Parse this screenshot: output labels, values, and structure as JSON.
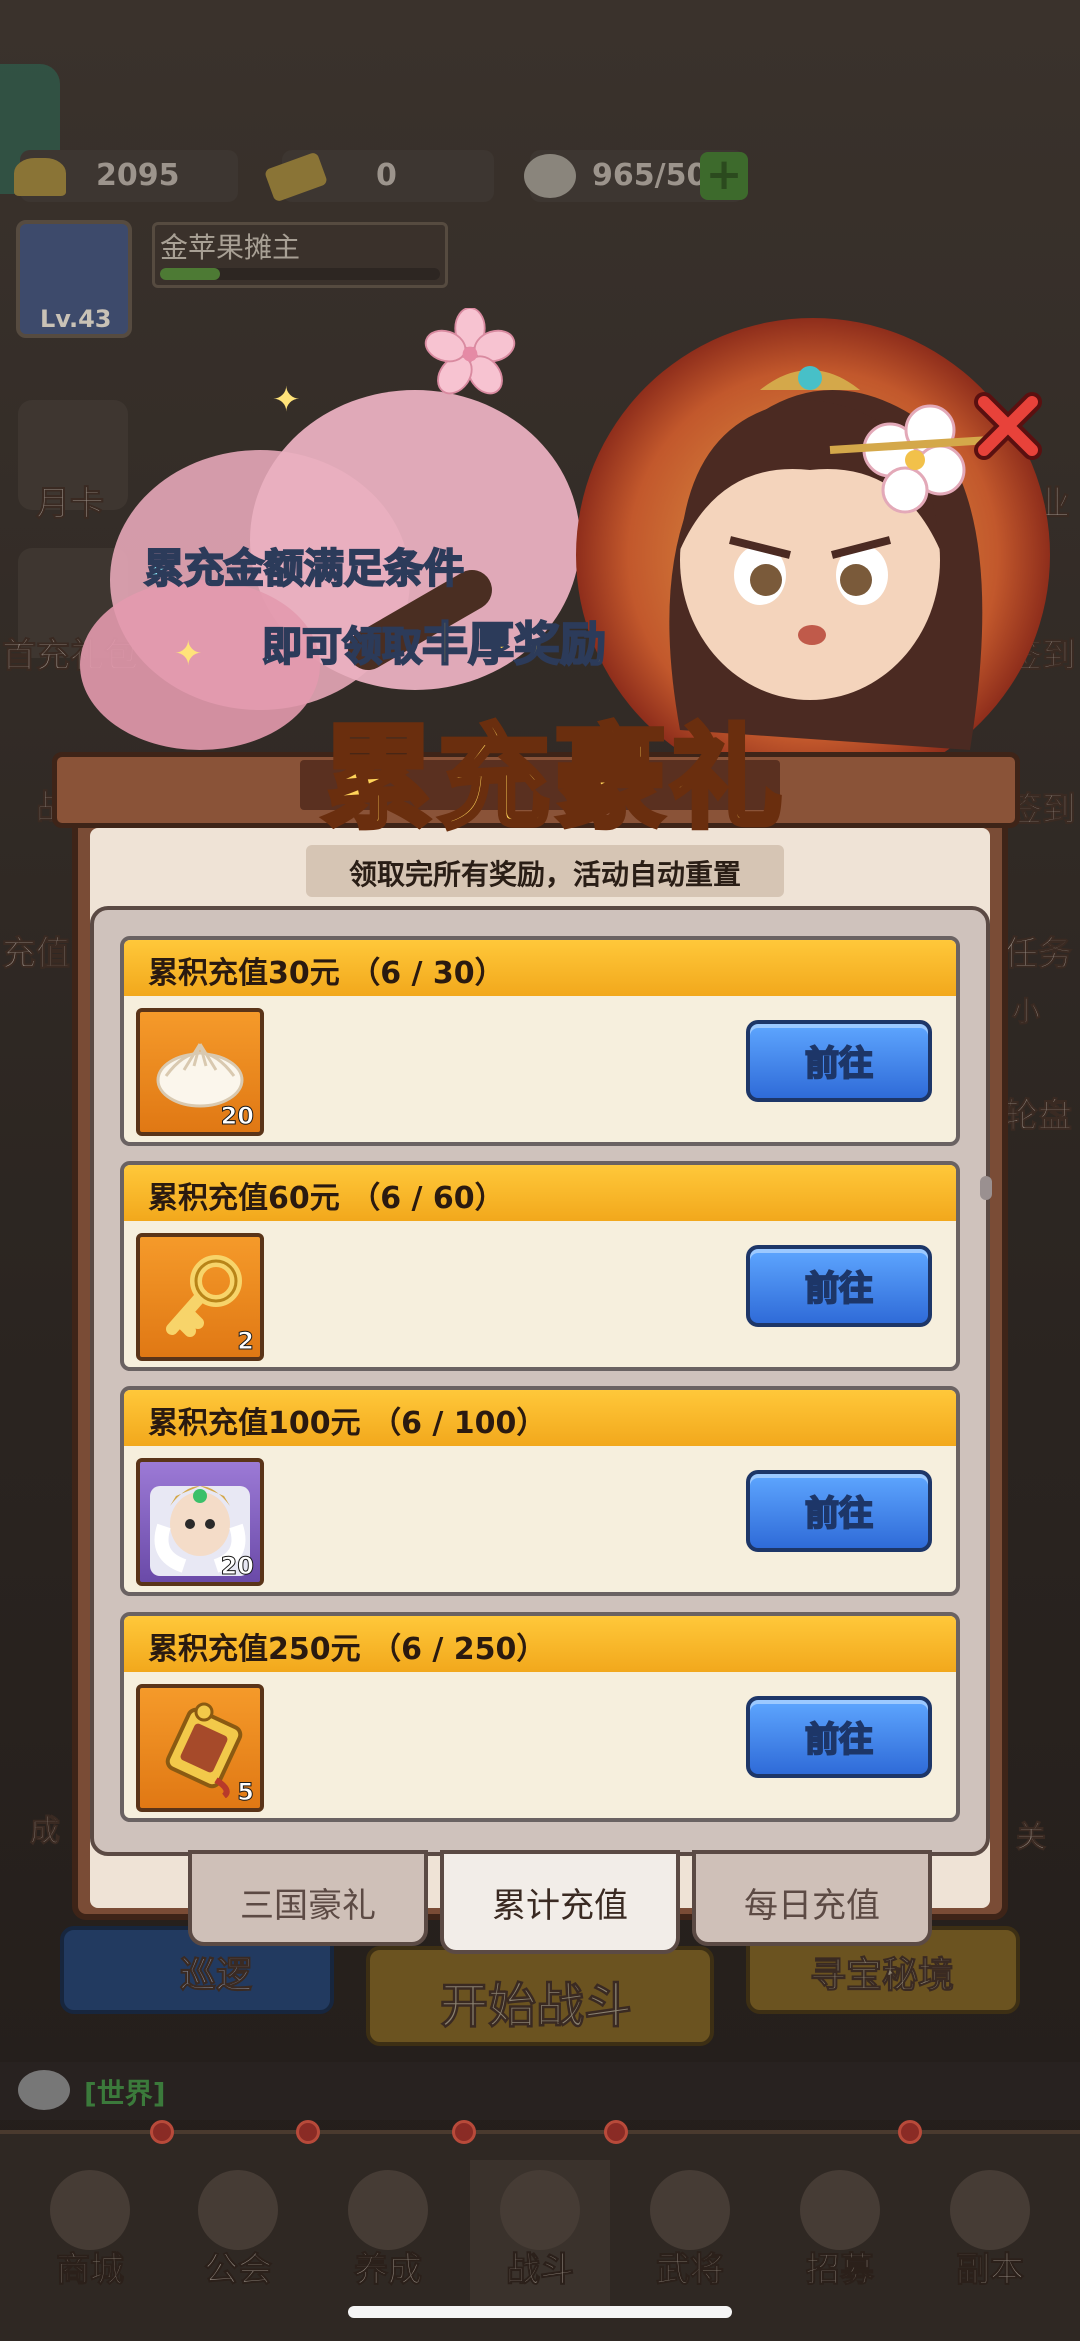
{
  "resources": {
    "gold": "2095",
    "ticket": "0",
    "stamina": "965/50"
  },
  "player": {
    "name": "金苹果摊主",
    "level": "Lv.43"
  },
  "side_menu": {
    "left": [
      "月卡",
      "首充礼包",
      "战",
      "充值"
    ],
    "right": [
      "业",
      "签到",
      "签到",
      "任务",
      "小",
      "轮盘"
    ]
  },
  "banner": {
    "line1": "累充金额满足条件",
    "line2_prefix": "即可领取",
    "line2_highlight": "丰厚奖励",
    "title": "累充豪礼"
  },
  "panel": {
    "subtitle": "领取完所有奖励，活动自动重置",
    "rewards": [
      {
        "title": "累积充值30元 （6 / 30）",
        "item_icon": "steamed-bun-icon",
        "count": "20",
        "button": "前往"
      },
      {
        "title": "累积充值60元 （6 / 60）",
        "item_icon": "golden-key-icon",
        "count": "2",
        "button": "前往"
      },
      {
        "title": "累积充值100元 （6 / 100）",
        "item_icon": "general-portrait-icon",
        "count": "20",
        "button": "前往"
      },
      {
        "title": "累积充值250元 （6 / 250）",
        "item_icon": "token-plaque-icon",
        "count": "5",
        "button": "前往"
      }
    ],
    "tabs": [
      {
        "label": "三国豪礼",
        "active": false
      },
      {
        "label": "累计充值",
        "active": true
      },
      {
        "label": "每日充值",
        "active": false
      }
    ]
  },
  "background_buttons": {
    "patrol": "巡逻",
    "start_battle": "开始战斗",
    "treasure": "寻宝秘境",
    "left_edge": "成",
    "right_edge": "关"
  },
  "chat": {
    "channel": "[世界]"
  },
  "nav": [
    "商城",
    "公会",
    "养成",
    "战斗",
    "武将",
    "招募",
    "副本"
  ],
  "colors": {
    "card_header": "#f7b52a",
    "go_button": "#3f84ec",
    "panel_border": "#7a4c36",
    "banner_title": "#ffd45a"
  }
}
